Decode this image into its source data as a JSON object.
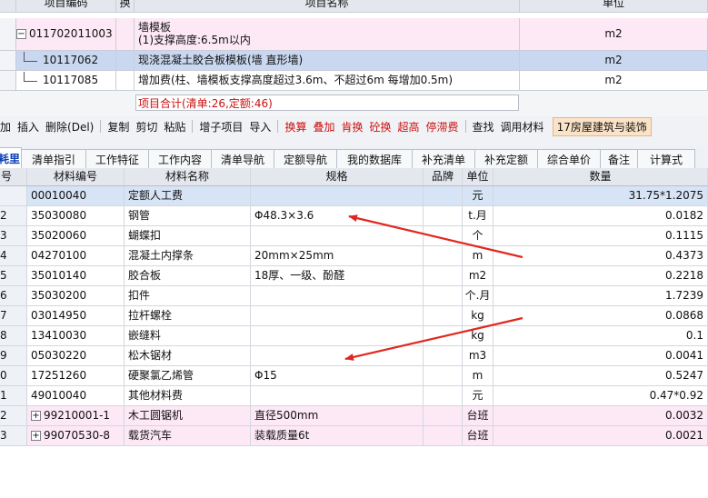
{
  "top_grid": {
    "headers": {
      "code": "项目编码",
      "swap": "换",
      "name": "项目名称",
      "unit": "单位"
    },
    "rows": [
      {
        "expander": "−",
        "code": "011702011003",
        "name_line1": "墙模板",
        "name_line2": "(1)支撑高度:6.5m以内",
        "unit": "m2"
      },
      {
        "code": "10117062",
        "name": "现浇混凝土胶合板模板(墙 直形墙)",
        "unit": "m2"
      },
      {
        "code": "10117085",
        "name": "增加费(柱、墙模板支撑高度超过3.6m、不超过6m 每增加0.5m)",
        "unit": "m2"
      }
    ],
    "summary": "项目合计(清单:26,定额:46)"
  },
  "toolbar": {
    "items": [
      {
        "label": "加",
        "red": false
      },
      {
        "label": "插入",
        "red": false
      },
      {
        "label": "删除(Del)",
        "red": false,
        "sep": true
      },
      {
        "label": "复制",
        "red": false
      },
      {
        "label": "剪切",
        "red": false
      },
      {
        "label": "粘贴",
        "red": false,
        "sep": true
      },
      {
        "label": "增子项目",
        "red": false
      },
      {
        "label": "导入",
        "red": false,
        "sep": true
      },
      {
        "label": "换算",
        "red": true
      },
      {
        "label": "叠加",
        "red": true
      },
      {
        "label": "肯换",
        "red": true
      },
      {
        "label": "砼换",
        "red": true
      },
      {
        "label": "超高",
        "red": true
      },
      {
        "label": "停滞费",
        "red": true,
        "sep": true
      },
      {
        "label": "查找",
        "red": false
      },
      {
        "label": "调用材料",
        "red": false
      }
    ],
    "category": "17房屋建筑与装饰"
  },
  "tabs": [
    "耗里",
    "清单指引",
    "工作特征",
    "工作内容",
    "清单导航",
    "定额导航",
    "我的数据库",
    "补充清单",
    "补充定额",
    "综合单价",
    "备注",
    "计算式"
  ],
  "materials": {
    "headers": {
      "no": "号",
      "code": "材料编号",
      "name": "材料名称",
      "spec": "规格",
      "brand": "品牌",
      "unit": "单位",
      "qty": "数量"
    },
    "rows": [
      {
        "no": "",
        "code": "00010040",
        "name": "定额人工费",
        "spec": "",
        "unit": "元",
        "qty": "31.75*1.2075"
      },
      {
        "no": "2",
        "code": "35030080",
        "name": "钢管",
        "spec": "Φ48.3×3.6",
        "unit": "t.月",
        "qty": "0.0182"
      },
      {
        "no": "3",
        "code": "35020060",
        "name": "蝴蝶扣",
        "spec": "",
        "unit": "个",
        "qty": "0.1115"
      },
      {
        "no": "4",
        "code": "04270100",
        "name": "混凝土内撑条",
        "spec": "20mm×25mm",
        "unit": "m",
        "qty": "0.4373"
      },
      {
        "no": "5",
        "code": "35010140",
        "name": "胶合板",
        "spec": "18厚、一级、酚醛",
        "unit": "m2",
        "qty": "0.2218"
      },
      {
        "no": "6",
        "code": "35030200",
        "name": "扣件",
        "spec": "",
        "unit": "个.月",
        "qty": "1.7239"
      },
      {
        "no": "7",
        "code": "03014950",
        "name": "拉杆螺栓",
        "spec": "",
        "unit": "kg",
        "qty": "0.0868"
      },
      {
        "no": "8",
        "code": "13410030",
        "name": "嵌缝料",
        "spec": "",
        "unit": "kg",
        "qty": "0.1"
      },
      {
        "no": "9",
        "code": "05030220",
        "name": "松木锯材",
        "spec": "",
        "unit": "m3",
        "qty": "0.0041"
      },
      {
        "no": "0",
        "code": "17251260",
        "name": "硬聚氯乙烯管",
        "spec": "Φ15",
        "unit": "m",
        "qty": "0.5247"
      },
      {
        "no": "1",
        "code": "49010040",
        "name": "其他材料费",
        "spec": "",
        "unit": "元",
        "qty": "0.47*0.92"
      },
      {
        "no": "2",
        "code": "99210001-1",
        "name": "木工圆锯机",
        "spec": "直径500mm",
        "unit": "台班",
        "qty": "0.0032",
        "expandable": true
      },
      {
        "no": "3",
        "code": "99070530-8",
        "name": "载货汽车",
        "spec": "装载质量6t",
        "unit": "台班",
        "qty": "0.0021",
        "expandable": true
      }
    ]
  },
  "colors": {
    "pink_row": "#fde8f5",
    "selected_row": "#c9d8f0",
    "arrow": "#e0281f",
    "tab_active_text": "#0a3fb5"
  }
}
